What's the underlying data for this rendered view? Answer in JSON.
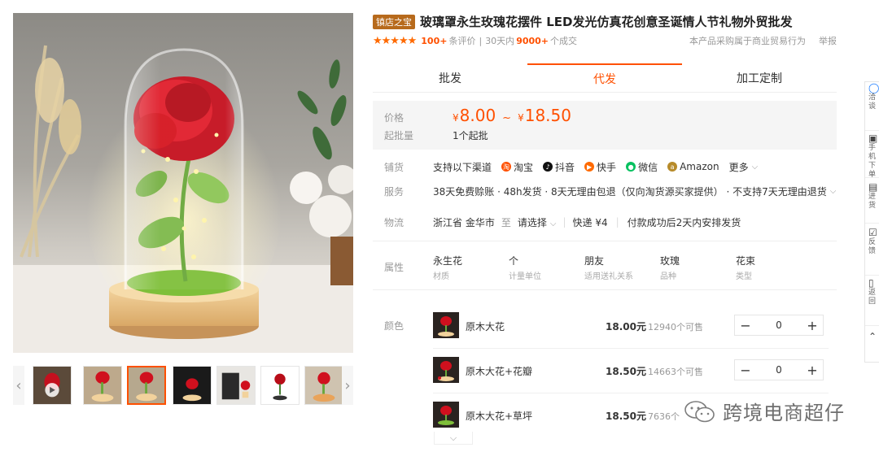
{
  "product": {
    "shop_tag": "镇店之宝",
    "title": "玻璃罩永生玫瑰花摆件 LED发光仿真花创意圣诞情人节礼物外贸批发",
    "stars": "★★★★★",
    "review_count": "100+",
    "review_label": "条评价",
    "sales_sep": "|",
    "sales_label": "30天内",
    "sales_count": "9000+",
    "sales_suffix": "个成交",
    "note": "本产品采购属于商业贸易行为",
    "report": "举报"
  },
  "tabs": [
    "批发",
    "代发",
    "加工定制"
  ],
  "price_box": {
    "price_label": "价格",
    "currency": "¥",
    "price_low": "8.00",
    "price_sep": "~",
    "price_high": "18.50",
    "moq_label": "起批量",
    "moq_value": "1个起批"
  },
  "shop_channels": {
    "label": "铺货",
    "intro": "支持以下渠道",
    "channels": [
      {
        "name": "淘宝",
        "color": "#ff5000",
        "icon": "taobao-icon"
      },
      {
        "name": "抖音",
        "color": "#111111",
        "icon": "douyin-icon"
      },
      {
        "name": "快手",
        "color": "#ff6a00",
        "icon": "kuaishou-icon"
      },
      {
        "name": "微信",
        "color": "#07c160",
        "icon": "wechat-icon"
      },
      {
        "name": "Amazon",
        "color": "#b78b2a",
        "icon": "amazon-icon"
      }
    ],
    "more": "更多"
  },
  "service": {
    "label": "服务",
    "text": "38天免费赊账 · 48h发货 · 8天无理由包退（仅向淘货源买家提供） · 不支持7天无理由退货"
  },
  "logistics": {
    "label": "物流",
    "origin": "浙江省 金华市",
    "to": "至",
    "destination": "请选择",
    "express": "快递 ¥4",
    "dispatch": "付款成功后2天内安排发货"
  },
  "attributes": {
    "label": "属性",
    "items": [
      {
        "value": "永生花",
        "key": "材质"
      },
      {
        "value": "个",
        "key": "计量单位"
      },
      {
        "value": "朋友",
        "key": "适用送礼关系"
      },
      {
        "value": "玫瑰",
        "key": "品种"
      },
      {
        "value": "花束",
        "key": "类型"
      }
    ]
  },
  "skus": {
    "label": "颜色",
    "items": [
      {
        "name": "原木大花",
        "price": "18.00元",
        "stock": "12940个可售",
        "qty": "0",
        "minus": "−",
        "plus": "+"
      },
      {
        "name": "原木大花+花瓣",
        "price": "18.50元",
        "stock": "14663个可售",
        "qty": "0",
        "minus": "−",
        "plus": "+"
      },
      {
        "name": "原木大花+草坪",
        "price": "18.50元",
        "stock": "7636个",
        "qty": "",
        "minus": "",
        "plus": ""
      }
    ]
  },
  "watermark": {
    "text": "跨境电商超仔"
  },
  "side_bar": {
    "items": [
      "洽谈",
      "手机下单",
      "进货",
      "反馈",
      "返回"
    ]
  },
  "colors": {
    "accent": "#ff5000",
    "shop_tag_bg": "#b76a1c"
  }
}
